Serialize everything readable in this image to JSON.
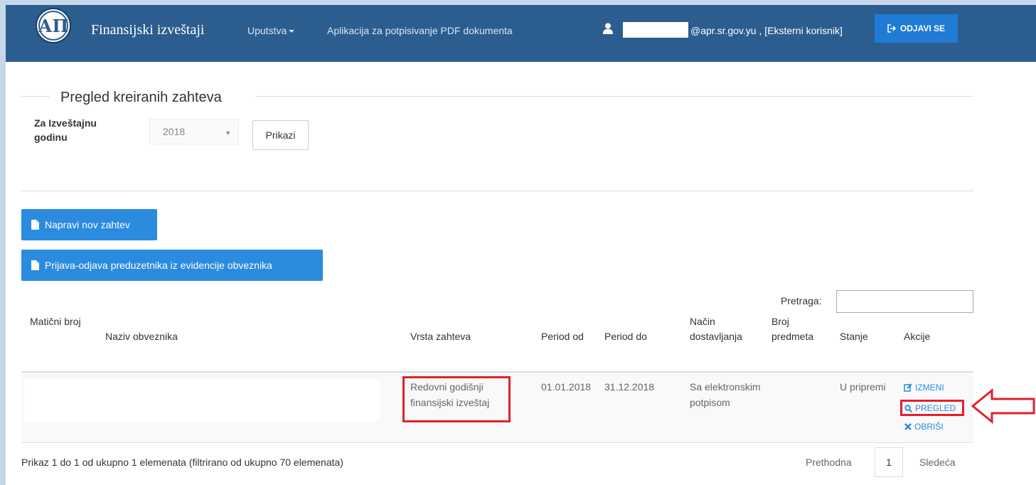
{
  "header": {
    "brand": "Finansijski izveštaji",
    "menu_instructions": "Uputstva",
    "menu_pdf_app": "Aplikacija za potpisivanje PDF dokumenta",
    "user_text": "@apr.sr.gov.yu , [Eksterni korisnik]",
    "logout_label": "ODJAVI SE",
    "logo_text": "АП"
  },
  "page": {
    "title": "Pregled kreiranih zahteva",
    "year_label": "Za Izveštajnu godinu",
    "year_value": "2018",
    "show_button": "Prikazi",
    "new_request_button": "Napravi nov zahtev",
    "entrepreneur_button": "Prijava-odjava preduzetnika iz evidencije obveznika",
    "search_label": "Pretraga:"
  },
  "table": {
    "columns": {
      "maticni": "Matični broj",
      "naziv": "Naziv obveznika",
      "vrsta": "Vrsta zahteva",
      "period_od": "Period od",
      "period_do": "Period do",
      "nacin": "Način dostavljanja",
      "broj": "Broj predmeta",
      "stanje": "Stanje",
      "akcije": "Akcije"
    },
    "rows": [
      {
        "vrsta": "Redovni godišnji finansijski izveštaj",
        "period_od": "01.01.2018",
        "period_do": "31.12.2018",
        "nacin": "Sa elektronskim potpisom",
        "stanje": "U pripremi",
        "actions": {
          "edit": "IZMENI",
          "view": "PREGLED",
          "delete": "OBRIŠI"
        }
      }
    ]
  },
  "footer": {
    "info": "Prikaz 1 do 1 od ukupno 1 elemenata (filtrirano od ukupno 70 elemenata)",
    "prev": "Prethodna",
    "page": "1",
    "next": "Sledeća"
  },
  "colors": {
    "navbar": "#2b5d8f",
    "button_blue": "#2a8bdf",
    "annotation_red": "#e4202a"
  }
}
